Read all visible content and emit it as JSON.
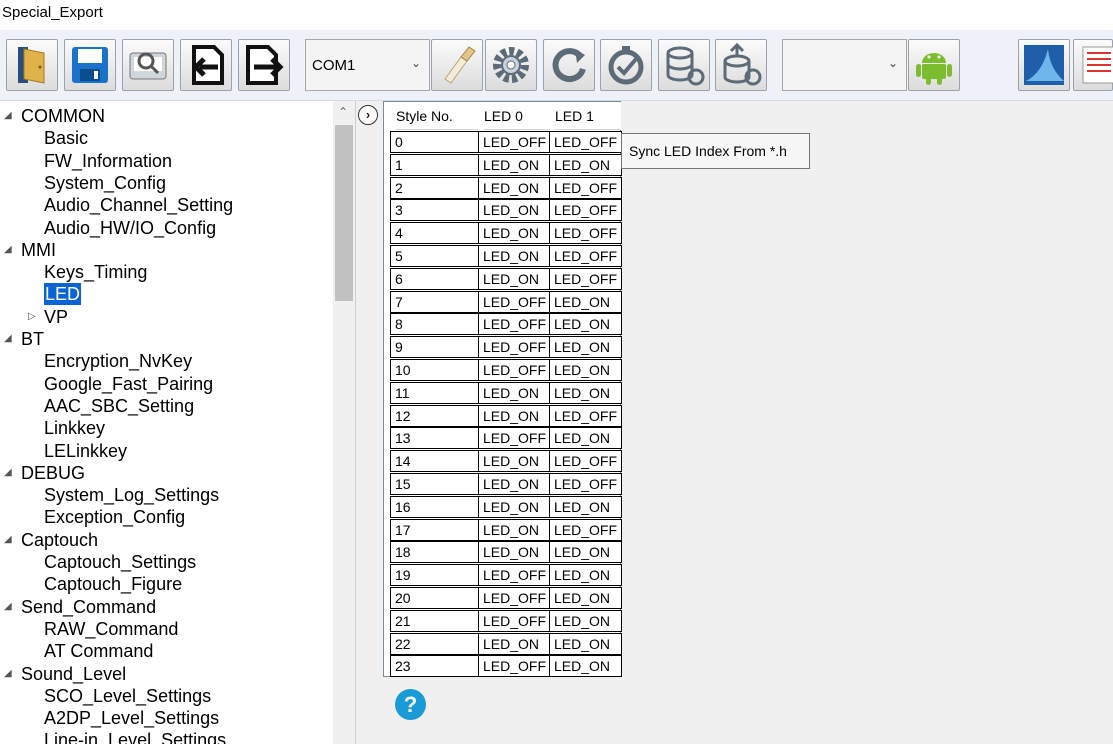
{
  "window": {
    "title": "Special_Export"
  },
  "toolbar": {
    "com_port": "COM1",
    "empty_combo": "",
    "buttons": [
      "open-folder",
      "save",
      "preview",
      "import",
      "export",
      "com-select",
      "clear",
      "settings",
      "refresh",
      "sync",
      "db-refresh",
      "upload",
      "android",
      "app",
      "notes"
    ]
  },
  "tree": [
    {
      "label": "COMMON",
      "level": 0,
      "expander": "down",
      "selected": false
    },
    {
      "label": "Basic",
      "level": 1,
      "expander": "",
      "selected": false
    },
    {
      "label": "FW_Information",
      "level": 1,
      "expander": "",
      "selected": false
    },
    {
      "label": "System_Config",
      "level": 1,
      "expander": "",
      "selected": false
    },
    {
      "label": "Audio_Channel_Setting",
      "level": 1,
      "expander": "",
      "selected": false
    },
    {
      "label": "Audio_HW/IO_Config",
      "level": 1,
      "expander": "",
      "selected": false
    },
    {
      "label": "MMI",
      "level": 0,
      "expander": "down",
      "selected": false
    },
    {
      "label": "Keys_Timing",
      "level": 1,
      "expander": "",
      "selected": false
    },
    {
      "label": "LED",
      "level": 1,
      "expander": "",
      "selected": true
    },
    {
      "label": "VP",
      "level": 1,
      "expander": "right",
      "selected": false
    },
    {
      "label": "BT",
      "level": 0,
      "expander": "down",
      "selected": false
    },
    {
      "label": "Encryption_NvKey",
      "level": 1,
      "expander": "",
      "selected": false
    },
    {
      "label": "Google_Fast_Pairing",
      "level": 1,
      "expander": "",
      "selected": false
    },
    {
      "label": "AAC_SBC_Setting",
      "level": 1,
      "expander": "",
      "selected": false
    },
    {
      "label": "Linkkey",
      "level": 1,
      "expander": "",
      "selected": false
    },
    {
      "label": "LELinkkey",
      "level": 1,
      "expander": "",
      "selected": false
    },
    {
      "label": "DEBUG",
      "level": 0,
      "expander": "down",
      "selected": false
    },
    {
      "label": "System_Log_Settings",
      "level": 1,
      "expander": "",
      "selected": false
    },
    {
      "label": "Exception_Config",
      "level": 1,
      "expander": "",
      "selected": false
    },
    {
      "label": "Captouch",
      "level": 0,
      "expander": "down",
      "selected": false
    },
    {
      "label": "Captouch_Settings",
      "level": 1,
      "expander": "",
      "selected": false
    },
    {
      "label": "Captouch_Figure",
      "level": 1,
      "expander": "",
      "selected": false
    },
    {
      "label": "Send_Command",
      "level": 0,
      "expander": "down",
      "selected": false
    },
    {
      "label": "RAW_Command",
      "level": 1,
      "expander": "",
      "selected": false
    },
    {
      "label": "AT Command",
      "level": 1,
      "expander": "",
      "selected": false
    },
    {
      "label": "Sound_Level",
      "level": 0,
      "expander": "down",
      "selected": false
    },
    {
      "label": "SCO_Level_Settings",
      "level": 1,
      "expander": "",
      "selected": false
    },
    {
      "label": "A2DP_Level_Settings",
      "level": 1,
      "expander": "",
      "selected": false
    },
    {
      "label": "Line-in_Level_Settings",
      "level": 1,
      "expander": "",
      "selected": false
    }
  ],
  "grid": {
    "headers": [
      "Style No.",
      "LED 0",
      "LED 1"
    ],
    "rows": [
      [
        "0",
        "LED_OFF",
        "LED_OFF"
      ],
      [
        "1",
        "LED_ON",
        "LED_ON"
      ],
      [
        "2",
        "LED_ON",
        "LED_OFF"
      ],
      [
        "3",
        "LED_ON",
        "LED_OFF"
      ],
      [
        "4",
        "LED_ON",
        "LED_OFF"
      ],
      [
        "5",
        "LED_ON",
        "LED_OFF"
      ],
      [
        "6",
        "LED_ON",
        "LED_OFF"
      ],
      [
        "7",
        "LED_OFF",
        "LED_ON"
      ],
      [
        "8",
        "LED_OFF",
        "LED_ON"
      ],
      [
        "9",
        "LED_OFF",
        "LED_ON"
      ],
      [
        "10",
        "LED_OFF",
        "LED_ON"
      ],
      [
        "11",
        "LED_ON",
        "LED_ON"
      ],
      [
        "12",
        "LED_ON",
        "LED_OFF"
      ],
      [
        "13",
        "LED_OFF",
        "LED_ON"
      ],
      [
        "14",
        "LED_ON",
        "LED_OFF"
      ],
      [
        "15",
        "LED_ON",
        "LED_OFF"
      ],
      [
        "16",
        "LED_ON",
        "LED_ON"
      ],
      [
        "17",
        "LED_ON",
        "LED_OFF"
      ],
      [
        "18",
        "LED_ON",
        "LED_ON"
      ],
      [
        "19",
        "LED_OFF",
        "LED_ON"
      ],
      [
        "20",
        "LED_OFF",
        "LED_ON"
      ],
      [
        "21",
        "LED_OFF",
        "LED_ON"
      ],
      [
        "22",
        "LED_ON",
        "LED_ON"
      ],
      [
        "23",
        "LED_OFF",
        "LED_ON"
      ]
    ]
  },
  "tooltip": "Sync LED Index From *.h",
  "help_icon": "?"
}
